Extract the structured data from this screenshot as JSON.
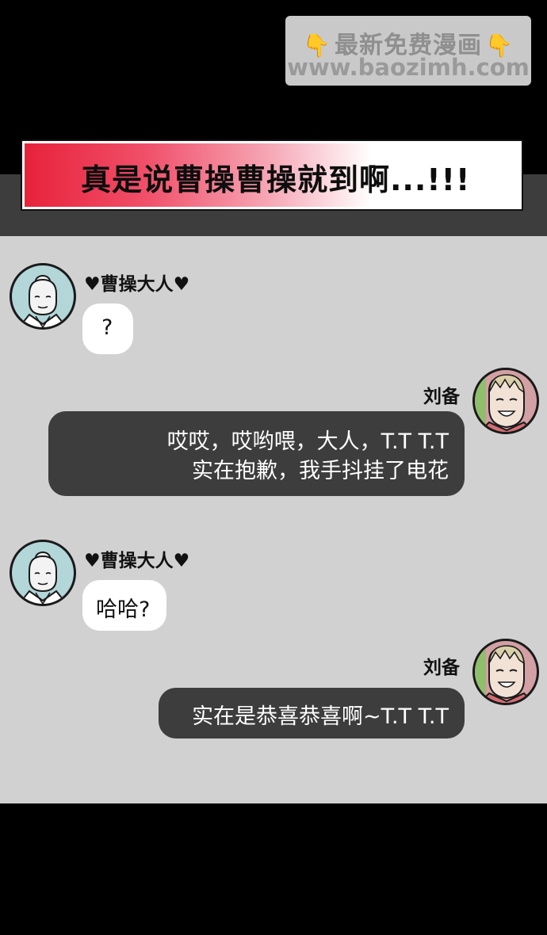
{
  "watermark": {
    "line1": "最新免费漫画",
    "line2": "www.baozimh.com",
    "left_emoji": "👇",
    "right_emoji": "👇"
  },
  "banner": {
    "text": "真是说曹操曹操就到啊...!!!"
  },
  "messages": [
    {
      "sender": "♥曹操大人♥",
      "lines": [
        "?"
      ]
    },
    {
      "sender": "刘备",
      "lines": [
        "哎哎，哎哟喂，大人，T.T T.T",
        "实在抱歉，我手抖挂了电花"
      ]
    },
    {
      "sender": "♥曹操大人♥",
      "lines": [
        "哈哈?"
      ]
    },
    {
      "sender": "刘备",
      "lines": [
        "实在是恭喜恭喜啊~T.T T.T"
      ]
    }
  ],
  "colors": {
    "page_bg": "#000000",
    "chat_bg": "#d1d1d1",
    "header_band": "#3d3d3d",
    "bubble_dark": "#3d3d3d",
    "bubble_light": "#ffffff",
    "banner_red": "#e8213a"
  }
}
